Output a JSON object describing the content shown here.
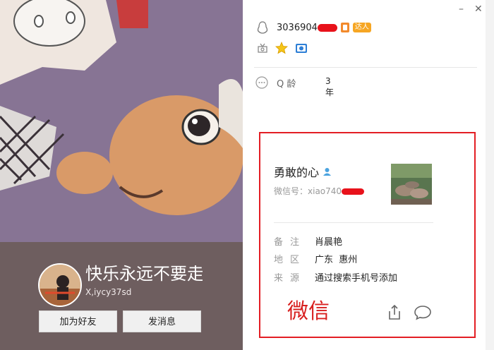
{
  "profile": {
    "nickname": "快乐永远不要走",
    "user_id": "X,iycy37sd",
    "add_friend_label": "加为好友",
    "send_message_label": "发消息"
  },
  "qq": {
    "number": "3036904",
    "badge": "达人",
    "age_label": "Q 龄",
    "age_value": "3年"
  },
  "wechat": {
    "name": "勇敢的心",
    "id_label": "微信号：",
    "id_value": "xiao740",
    "remark_label": "备注",
    "remark_value": "肖晨艳",
    "region_label": "地区",
    "region_value": "广东  惠州",
    "source_label": "来源",
    "source_value": "通过搜索手机号添加",
    "title": "微信"
  },
  "window": {
    "minimize": "–",
    "close": "✕"
  },
  "colors": {
    "highlight_border": "#e31e24",
    "redaction": "#e8121b",
    "wechat_title": "#d8201f"
  },
  "icons": [
    "qq-penguin-icon",
    "wechat-icon",
    "star-icon",
    "camera-icon",
    "more-icon",
    "share-icon",
    "chat-bubble-icon",
    "person-icon"
  ]
}
